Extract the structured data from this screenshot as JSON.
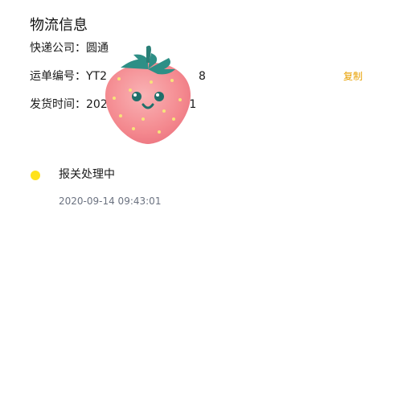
{
  "logistics": {
    "title": "物流信息",
    "company_label": "快递公司：",
    "company_value": "圆通",
    "waybill_label": "运单编号：",
    "waybill_value": "YT2",
    "waybill_tail": "8",
    "copy_label": "复制",
    "ship_time_label": "发货时间：",
    "ship_time_value": "202",
    "ship_time_tail": ":41"
  },
  "timeline": {
    "items": [
      {
        "status": "报关处理中",
        "time": "2020-09-14 09:43:01"
      }
    ]
  },
  "colors": {
    "accent": "#e8a000",
    "dot": "#ffe21a",
    "strawberry": "#f4898f",
    "leaf": "#2e8f86"
  },
  "icons": {
    "mascot": "strawberry-mascot-icon"
  }
}
